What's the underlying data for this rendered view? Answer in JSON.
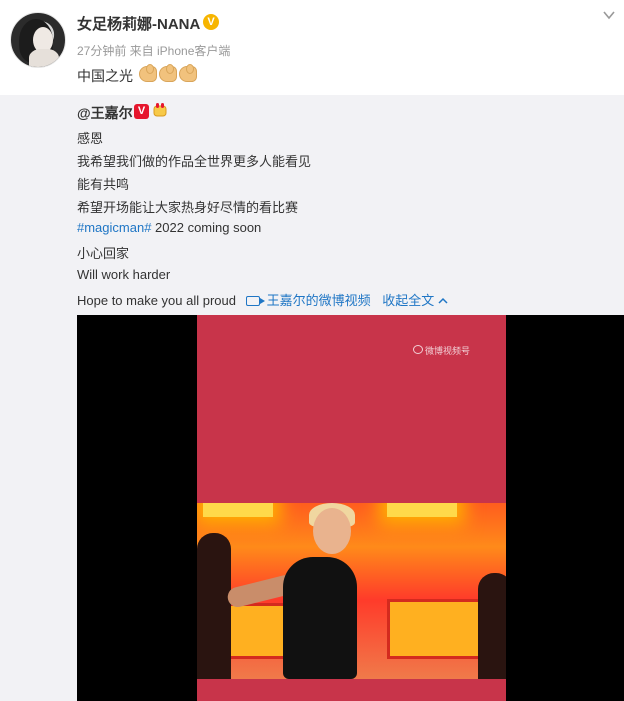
{
  "post": {
    "author": "女足杨莉娜-NANA",
    "verified_mark": "V",
    "meta": "27分钟前 来自 iPhone客户端",
    "text": "中国之光",
    "emoji": [
      "flexed-biceps",
      "flexed-biceps",
      "flexed-biceps"
    ]
  },
  "repost": {
    "author": "@王嘉尔",
    "vip_mark": "V",
    "lines": [
      "感恩",
      "我希望我们做的作品全世界更多人能看见",
      "能有共鸣",
      "希望开场能让大家热身好尽情的看比赛"
    ],
    "hashtag": "#magicman#",
    "hashtag_suffix": " 2022 coming soon",
    "line_home": "小心回家",
    "line_work": "Will work harder",
    "line_hope": "Hope to make you all proud",
    "video_link": "王嘉尔的微博视频",
    "collapse": "收起全文",
    "video_watermark": "微博视频号"
  },
  "colors": {
    "link": "#1f76c5",
    "repost_bg": "#f2f2f5",
    "video_bg": "#c8344a",
    "verified": "#f7b500",
    "vip": "#e6162d"
  },
  "icons": [
    "avatar",
    "verified-icon",
    "chevron-down-icon",
    "vip-badge-icon",
    "raised-fist-icon",
    "video-link-icon",
    "chevron-up-icon",
    "weibo-logo-icon"
  ]
}
